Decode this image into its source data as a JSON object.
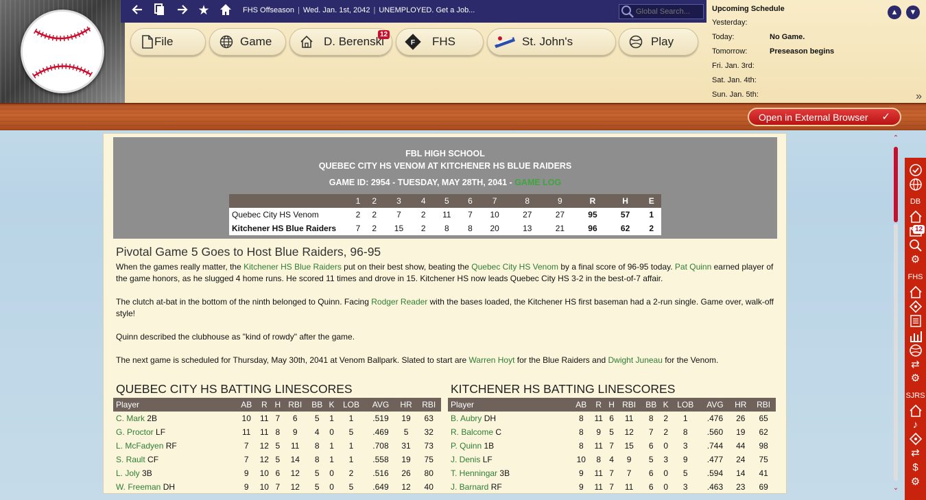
{
  "topbar": {
    "league": "FHS Offseason",
    "date": "Wed. Jan. 1st, 2042",
    "status": "UNEMPLOYED. Get a Job...",
    "search_placeholder": "Global Search...",
    "icons": [
      "back-arrow-icon",
      "copy-icon",
      "forward-arrow-icon",
      "star-icon",
      "home-icon"
    ]
  },
  "menu": {
    "file": "File",
    "game": "Game",
    "manager": "D. Berenski",
    "manager_badge": "12",
    "team": "FHS",
    "club": "St. John's",
    "play": "Play"
  },
  "schedule": {
    "title": "Upcoming Schedule",
    "rows": [
      {
        "day": "Yesterday:",
        "value": ""
      },
      {
        "day": "Today:",
        "value": "No Game."
      },
      {
        "day": "Tomorrow:",
        "value": "Preseason begins"
      },
      {
        "day": "Fri. Jan. 3rd:",
        "value": ""
      },
      {
        "day": "Sat. Jan. 4th:",
        "value": ""
      },
      {
        "day": "Sun. Jan. 5th:",
        "value": ""
      }
    ]
  },
  "external_button": "Open in External Browser",
  "game": {
    "league_title": "FBL HIGH SCHOOL",
    "matchup": "QUEBEC CITY HS VENOM AT KITCHENER HS BLUE RAIDERS",
    "game_id_text": "GAME ID: 2954 - TUESDAY, MAY 28TH, 2041 -",
    "game_log": "GAME LOG",
    "innings": [
      "1",
      "2",
      "3",
      "4",
      "5",
      "6",
      "7",
      "8",
      "9"
    ],
    "totals_headers": [
      "R",
      "H",
      "E"
    ],
    "away": {
      "name": "Quebec City HS Venom",
      "innings": [
        "2",
        "2",
        "7",
        "2",
        "11",
        "7",
        "10",
        "27",
        "27"
      ],
      "r": "95",
      "h": "57",
      "e": "1"
    },
    "home": {
      "name": "Kitchener HS Blue Raiders",
      "innings": [
        "7",
        "2",
        "15",
        "2",
        "8",
        "8",
        "20",
        "13",
        "21"
      ],
      "r": "96",
      "h": "62",
      "e": "2"
    }
  },
  "story": {
    "title": "Pivotal Game 5 Goes to Host Blue Raiders, 96-95",
    "p1": [
      "When the games really matter, the ",
      "Kitchener HS Blue Raiders",
      " put on their best show, beating the ",
      "Quebec City HS Venom",
      " by a final score of 96-95 today. ",
      "Pat Quinn",
      " earned player of the game honors, as he slugged 4 home runs. He scored 11 times and drove in 15. Kitchener HS now leads Quebec City HS 3-2 in the best-of-7 affair."
    ],
    "p2": [
      "The clutch at-bat in the bottom of the ninth belonged to Quinn. Facing ",
      "Rodger Reader",
      " with the bases loaded, the Kitchener HS first baseman had a 2-run single. Game over, walk-off style!"
    ],
    "p3": "Quinn described the clubhouse as \"kind of rowdy\" after the game.",
    "p4": [
      "The next game is scheduled for Thursday, May 30th, 2041 at Venom Ballpark. Slated to start are ",
      "Warren Hoyt",
      " for the Blue Raiders and ",
      "Dwight Juneau",
      " for the Venom."
    ]
  },
  "batting_columns": [
    "Player",
    "AB",
    "R",
    "H",
    "RBI",
    "BB",
    "K",
    "LOB",
    "AVG",
    "HR",
    "RBI"
  ],
  "away_batting": {
    "title": "QUEBEC CITY HS BATTING LINESCORES",
    "rows": [
      {
        "name": "C. Mark",
        "pos": "2B",
        "stats": [
          "10",
          "11",
          "7",
          "6",
          "5",
          "1",
          "1",
          ".519",
          "19",
          "63"
        ]
      },
      {
        "name": "G. Proctor",
        "pos": "LF",
        "stats": [
          "11",
          "11",
          "8",
          "9",
          "4",
          "0",
          "5",
          ".469",
          "5",
          "32"
        ]
      },
      {
        "name": "L. McFadyen",
        "pos": "RF",
        "stats": [
          "7",
          "12",
          "5",
          "11",
          "8",
          "1",
          "1",
          ".708",
          "31",
          "73"
        ]
      },
      {
        "name": "S. Rault",
        "pos": "CF",
        "stats": [
          "7",
          "12",
          "5",
          "14",
          "8",
          "1",
          "1",
          ".558",
          "19",
          "75"
        ]
      },
      {
        "name": "L. Joly",
        "pos": "3B",
        "stats": [
          "9",
          "10",
          "6",
          "12",
          "5",
          "0",
          "2",
          ".516",
          "26",
          "80"
        ]
      },
      {
        "name": "W. Freeman",
        "pos": "DH",
        "stats": [
          "9",
          "10",
          "7",
          "12",
          "5",
          "0",
          "5",
          ".649",
          "12",
          "40"
        ]
      }
    ]
  },
  "home_batting": {
    "title": "KITCHENER HS BATTING LINESCORES",
    "rows": [
      {
        "name": "B. Aubry",
        "pos": "DH",
        "stats": [
          "8",
          "11",
          "6",
          "11",
          "8",
          "2",
          "1",
          ".476",
          "26",
          "65"
        ]
      },
      {
        "name": "R. Balcome",
        "pos": "C",
        "stats": [
          "8",
          "9",
          "5",
          "12",
          "7",
          "2",
          "8",
          ".560",
          "19",
          "62"
        ]
      },
      {
        "name": "P. Quinn",
        "pos": "1B",
        "stats": [
          "8",
          "11",
          "7",
          "15",
          "6",
          "0",
          "3",
          ".744",
          "44",
          "98"
        ]
      },
      {
        "name": "J. Denis",
        "pos": "LF",
        "stats": [
          "10",
          "8",
          "4",
          "9",
          "5",
          "3",
          "9",
          ".477",
          "24",
          "75"
        ]
      },
      {
        "name": "T. Henningar",
        "pos": "3B",
        "stats": [
          "9",
          "11",
          "7",
          "7",
          "6",
          "0",
          "5",
          ".594",
          "14",
          "41"
        ]
      },
      {
        "name": "J. Barnard",
        "pos": "RF",
        "stats": [
          "9",
          "11",
          "7",
          "11",
          "6",
          "0",
          "3",
          ".463",
          "23",
          "69"
        ]
      }
    ]
  },
  "sidebar": {
    "labels": {
      "db": "DB",
      "fhs": "FHS",
      "sjrs": "SJRS"
    },
    "mail_badge": "12"
  }
}
